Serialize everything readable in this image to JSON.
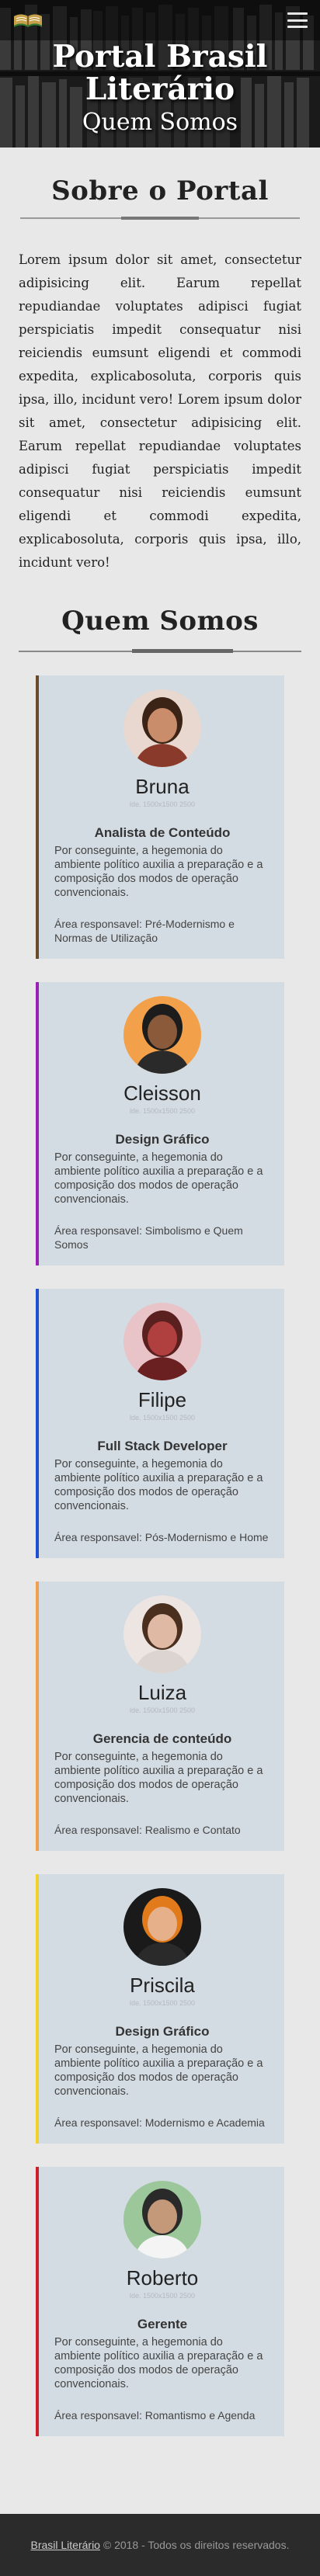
{
  "hero": {
    "title_line1": "Portal Brasil",
    "title_line2": "Literário",
    "subtitle": "Quem Somos"
  },
  "about": {
    "title": "Sobre o Portal",
    "paragraph": "Lorem ipsum dolor sit amet, consectetur adipisicing elit. Earum repellat repudiandae voluptates adipisci fugiat perspiciatis impedit consequatur nisi reiciendis eumsunt eligendi et commodi expedita, explicabosoluta, corporis quis ipsa, illo, incidunt vero! Lorem ipsum dolor sit amet, consectetur adipisicing elit. Earum repellat repudiandae voluptates adipisci fugiat perspiciatis impedit consequatur nisi reiciendis eumsunt eligendi et commodi expedita, explicabosoluta, corporis quis ipsa, illo, incidunt vero!"
  },
  "team": {
    "title": "Quem Somos",
    "members": [
      {
        "name": "Bruna",
        "caption": "lde. 1500x1500 2500",
        "role": "Analista de Conteúdo",
        "description": "Por conseguinte, a hegemonia do ambiente político auxilia a preparação e a composição dos modos de operação convencionais.",
        "area": "Área responsavel: Pré-Modernismo e Normas de Utilização",
        "accent": "#6b4a2a"
      },
      {
        "name": "Cleisson",
        "caption": "lde. 1500x1500 2500",
        "role": "Design Gráfico",
        "description": "Por conseguinte, a hegemonia do ambiente político auxilia a preparação e a composição dos modos de operação convencionais.",
        "area": "Área responsavel: Simbolismo e Quem Somos",
        "accent": "#9b1fb5"
      },
      {
        "name": "Filipe",
        "caption": "lde. 1500x1500 2500",
        "role": "Full Stack Developer",
        "description": "Por conseguinte, a hegemonia do ambiente político auxilia a preparação e a composição dos modos de operação convencionais.",
        "area": "Área responsavel: Pós-Modernismo e Home",
        "accent": "#1f4fd1"
      },
      {
        "name": "Luiza",
        "caption": "lde. 1500x1500 2500",
        "role": "Gerencia de conteúdo",
        "description": "Por conseguinte, a hegemonia do ambiente político auxilia a preparação e a composição dos modos de operação convencionais.",
        "area": "Área responsavel:  Realismo e Contato",
        "accent": "#f0a050"
      },
      {
        "name": "Priscila",
        "caption": "lde. 1500x1500 2500",
        "role": "Design Gráfico",
        "description": "Por conseguinte, a hegemonia do ambiente político auxilia a preparação e a composição dos modos de operação convencionais.",
        "area": "Área responsavel: Modernismo e Academia",
        "accent": "#f2d22a"
      },
      {
        "name": "Roberto",
        "caption": "lde. 1500x1500 2500",
        "role": "Gerente",
        "description": "Por conseguinte, a hegemonia do ambiente político auxilia a preparação e a composição dos modos de operação convencionais.",
        "area": "Área responsavel: Romantismo e Agenda",
        "accent": "#cc1f2a"
      }
    ]
  },
  "footer": {
    "link": "Brasil Literário",
    "text": " © 2018 - Todos os direitos reservados."
  }
}
